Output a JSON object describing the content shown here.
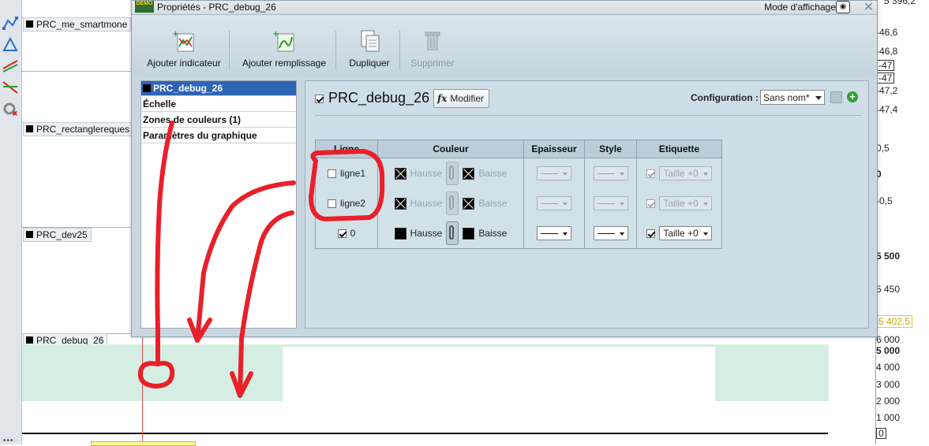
{
  "panes": [
    {
      "label": "PRC_me_smartmone"
    },
    {
      "label": "PRC_rectanglereques"
    },
    {
      "label": "PRC_dev25"
    },
    {
      "label": "PRC_debug_26"
    }
  ],
  "price_scale": {
    "top_partial": "5 396,2",
    "pane1": [
      "-46,6",
      "-46,8",
      "-47",
      "-47",
      "-47,2",
      "-47,4"
    ],
    "pane2": [
      "0,5",
      "0",
      "-0,5"
    ],
    "pane3": [
      "5 500",
      "5 450",
      "5 402,5"
    ],
    "pane4": [
      "6 000",
      "5 000",
      "4 000",
      "3 000",
      "2 000",
      "1 000",
      "0"
    ]
  },
  "dialog": {
    "title": "Propriétés - PRC_debug_26",
    "demo_badge": "DEMO",
    "mode_label": "Mode d'affichage",
    "toolbar": {
      "add_indicator": "Ajouter indicateur",
      "add_fill": "Ajouter remplissage",
      "duplicate": "Dupliquer",
      "delete": "Supprimer"
    },
    "nav": [
      "PRC_debug_26",
      "Échelle",
      "Zones de couleurs (1)",
      "Paramètres du graphique"
    ],
    "indicator_name": "PRC_debug_26",
    "modify_label": "Modifier",
    "fx_symbol": "fx",
    "config_label": "Configuration :",
    "config_value": "Sans nom*",
    "table": {
      "headers": [
        "Ligne",
        "Couleur",
        "Epaisseur",
        "Style",
        "Etiquette"
      ],
      "rows": [
        {
          "name": "ligne1",
          "checked": false,
          "up": "Hausse",
          "down": "Baisse",
          "label": "Taille +0",
          "enabled": false
        },
        {
          "name": "ligne2",
          "checked": false,
          "up": "Hausse",
          "down": "Baisse",
          "label": "Taille +0",
          "enabled": false
        },
        {
          "name": "0",
          "checked": true,
          "up": "Hausse",
          "down": "Baisse",
          "label": "Taille +0",
          "enabled": true
        }
      ]
    }
  },
  "colors": {
    "selection": "#2e64b4",
    "dialog_bg": "#c9d7e0",
    "histogram": "#d6ede4",
    "annotation": "#e8202a",
    "add_green": "#2fa23a"
  }
}
